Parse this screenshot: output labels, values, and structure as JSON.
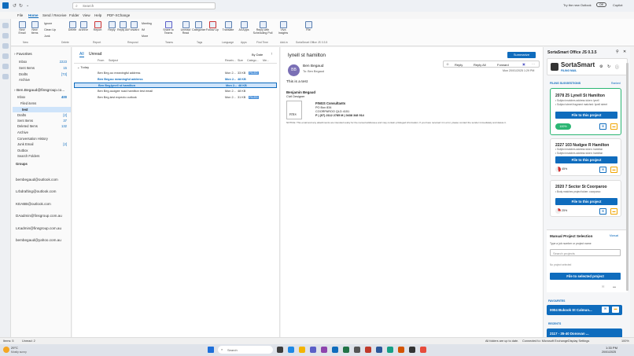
{
  "search": {
    "placeholder": "Search"
  },
  "titlebar": {
    "try_new": "Try the new Outlook",
    "toggle": "Off",
    "copilot": "Copilot"
  },
  "menu": [
    "File",
    "Home",
    "Send / Receive",
    "Folder",
    "View",
    "Help",
    "PDF-XChange"
  ],
  "ribbon": {
    "new_email": "New Email",
    "new_items": "New Items",
    "ignore": "Ignore",
    "clean_up": "Clean Up",
    "junk": "Junk",
    "delete": "Delete",
    "archive": "Archive",
    "report": "Report",
    "reply": "Reply",
    "reply_all": "Reply All",
    "forward": "Forward",
    "meeting": "Meeting",
    "im": "IM",
    "more": "More",
    "share_teams": "Share to Teams",
    "unread_read": "Unread/ Read",
    "categorize": "Categorize",
    "follow_up": "Follow Up",
    "translate": "Translate",
    "all_apps": "All Apps",
    "reply_sched": "Reply with Scheduling Poll",
    "insights": "Viva Insights",
    "file": "File",
    "groups": {
      "new": "New",
      "delete": "Delete",
      "report": "Report",
      "respond": "Respond",
      "teams": "Teams",
      "tags": "Tags",
      "language": "Language",
      "apps": "Apps",
      "find_time": "Find Time",
      "addin": "Add-in",
      "sortasmart": "SortaSmart Office JS 0.3.5"
    }
  },
  "folders": {
    "favorites": "Favorites",
    "fav_items": [
      {
        "name": "Inbox",
        "count": "2223"
      },
      {
        "name": "Sent Items",
        "count": "15"
      },
      {
        "name": "Drafts",
        "count": "[73]"
      },
      {
        "name": "Archive",
        "count": ""
      }
    ],
    "account": "Ben.Begaud@finsgroup.co...",
    "inbox_label": "Inbox",
    "inbox_count": "400",
    "sub_items": [
      {
        "name": "Filed items",
        "count": ""
      },
      {
        "name": "test",
        "count": ""
      },
      {
        "name": "Drafts",
        "count": "[2]"
      },
      {
        "name": "Sent Items",
        "count": "37"
      },
      {
        "name": "Deleted Items",
        "count": "132"
      },
      {
        "name": "Archive",
        "count": ""
      },
      {
        "name": "Conversation History",
        "count": ""
      },
      {
        "name": "Junk Email",
        "count": "[2]"
      },
      {
        "name": "Outbox",
        "count": ""
      },
      {
        "name": "Search Folders",
        "count": ""
      },
      {
        "name": "Groups",
        "count": ""
      }
    ],
    "accounts": [
      "bembegaud@outlook.com",
      "Lrbdrafting@outlook.com",
      "KEABB@outlook.com",
      "DAadmin@finsgroup.com.au",
      "LKadmin@finsgroup.com.au",
      "bembegaud@yahoo.com.au"
    ]
  },
  "msglist": {
    "tab_all": "All",
    "tab_unread": "Unread",
    "sort": "By Date",
    "headers": [
      "From",
      "Subject",
      "Receiv...",
      "Size",
      "Catego...",
      "Me..."
    ],
    "group_today": "Today",
    "rows": [
      {
        "from": "Ben Beg...",
        "subject": "no meaningful address",
        "received": "Mon 2...",
        "size": "33 KB",
        "cat": "FILED"
      },
      {
        "from": "Ben Beg...",
        "subject": "no meaningful address",
        "received": "Mon 2...",
        "size": "48 KB",
        "cat": ""
      },
      {
        "from": "Ben Beg...",
        "subject": "lynell st hamilton",
        "received": "Mon 2...",
        "size": "48 KB",
        "cat": ""
      },
      {
        "from": "Ben Beg...",
        "subject": "nudgee road hamilton test email",
        "received": "Mon 2...",
        "size": "48 KB",
        "cat": ""
      },
      {
        "from": "Ben Beg...",
        "subject": "test expecto outlook",
        "received": "Mon 2...",
        "size": "31 KB",
        "cat": "FILED"
      }
    ]
  },
  "reading": {
    "subject": "lynell st hamilton",
    "summarize": "Summarize",
    "sender": "Ben Begaud",
    "to": "Ben Begaud",
    "avatar": "BB",
    "reply": "Reply",
    "reply_all": "Reply All",
    "forward": "Forward",
    "date": "Mon 20/01/2025 1:29 PM",
    "body": "This is a test",
    "sig_name": "Benjamin Begaud",
    "sig_title": "Civil Designer",
    "company": "FINGS Consultants",
    "po": "PO Box 834",
    "city": "COORPAROO QLD 4151",
    "phone": "P | (07) 2112 2785 M | 0438 348 914",
    "logo": "FINS",
    "notice": "NOTICE: This email and any attachments are intended solely for the named addressee and may contain privileged information. If you have received it in error, please contact the sender immediately and delete it."
  },
  "pane": {
    "title": "SortaSmart Office JS 0.3.5",
    "brand": "SortaSmart",
    "brand_sub": "FILING MAIL",
    "suggested": "FILING SUGGESTIONS",
    "ranked": "Ranked",
    "cards": [
      {
        "title": "2078 25 Lynell St Hamilton",
        "l1": "• Subject matches address token: lynell",
        "l2": "• Subject street fragment matched: lynell street",
        "btn": "File to this project",
        "score": "100%",
        "score_val": 1.0
      },
      {
        "title": "2227 103 Nudgee R Hamilton",
        "l1": "• Subject matches address token: hamilton",
        "l2": "• Subject matches address token: hamilton",
        "btn": "File to this project",
        "score": "45%",
        "score_val": 0.45
      },
      {
        "title": "2020 7 Sector St Coorparoo",
        "l1": "• Body matches project token: coorparoo",
        "l2": "",
        "btn": "File to this project",
        "score": "25%",
        "score_val": 0.25
      }
    ],
    "manual_title": "Manual Project Selection",
    "manual_tag": "Manual",
    "manual_hint": "Type a job number or project name",
    "search_placeholder": "Search projects",
    "no_project": "No project selected",
    "file_selected": "File to selected project",
    "favourites": "FAVOURITES",
    "fav_item": "0004 Bukook St Calmun...",
    "recents": "RECENTS",
    "recent_item": "2117 - 35-40 Donovan ..."
  },
  "status": {
    "items": "Items: 5",
    "unread": "Unread: 2",
    "folders": "All folders are up to date.",
    "connected": "Connected to: Microsoft Exchange",
    "display": "Display Settings",
    "zoom": "100%"
  },
  "taskbar": {
    "temp": "29°C",
    "weather": "Mostly sunny",
    "search": "Search",
    "time": "1:33 PM",
    "date": "20/01/2025"
  }
}
